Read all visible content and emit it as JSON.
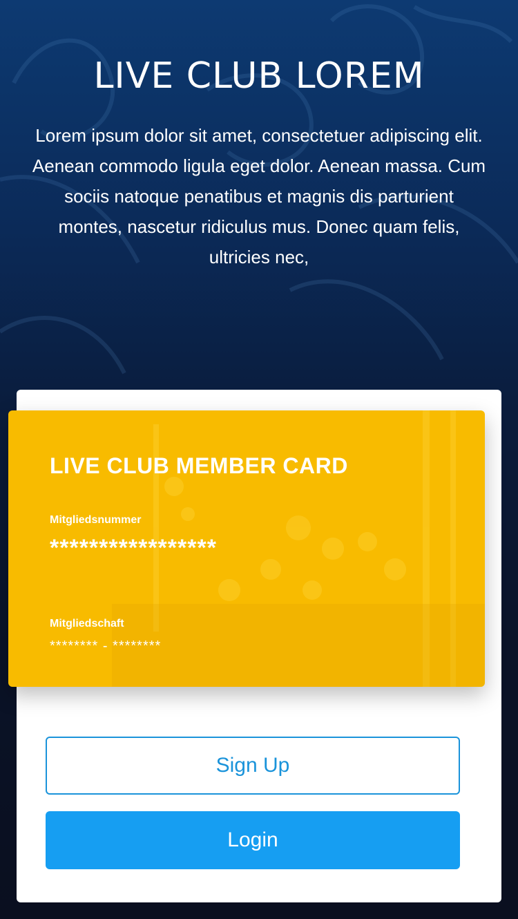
{
  "hero": {
    "title": "LIVE CLUB LOREM",
    "text": "Lorem ipsum dolor sit amet, consectetuer adipiscing elit. Aenean commodo ligula eget dolor. Aenean massa. Cum sociis natoque penatibus et magnis dis parturient montes, nascetur ridiculus mus. Donec quam felis, ultricies nec,"
  },
  "card": {
    "title": "LIVE CLUB MEMBER CARD",
    "number_label": "Mitgliedsnummer",
    "number_value": "*****************",
    "membership_label": "Mitgliedschaft",
    "membership_value": "******** - ********",
    "color": "#f8bb00"
  },
  "buttons": {
    "signup_label": "Sign Up",
    "login_label": "Login",
    "accent": "#169ef2"
  }
}
